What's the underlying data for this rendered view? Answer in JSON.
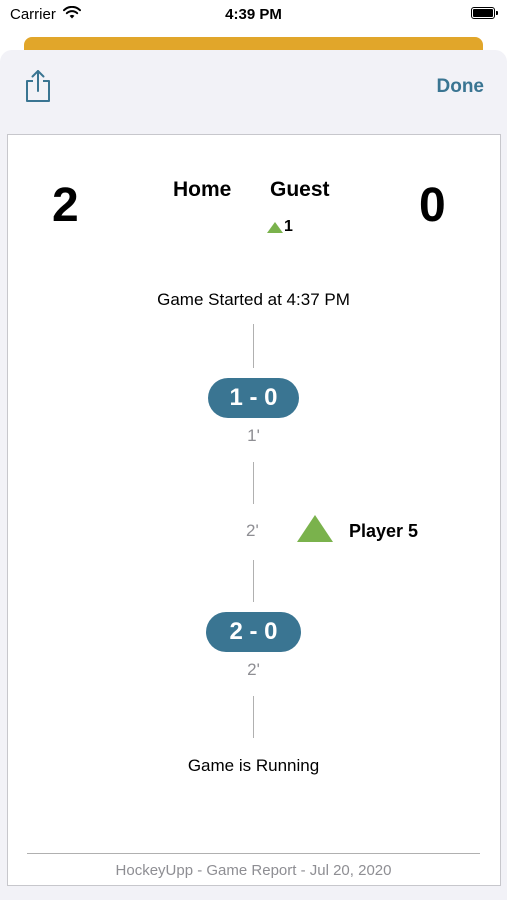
{
  "status_bar": {
    "carrier": "Carrier",
    "time": "4:39 PM"
  },
  "toolbar": {
    "done_label": "Done",
    "share_icon": "share-icon"
  },
  "scoreboard": {
    "home_name": "Home",
    "guest_name": "Guest",
    "home_score": "2",
    "guest_score": "0",
    "guest_penalty_count": "1"
  },
  "timeline": {
    "start_text": "Game Started at 4:37 PM",
    "goal1": {
      "score": "1 - 0",
      "minute": "1'"
    },
    "penalty": {
      "minute": "2'",
      "player": "Player 5"
    },
    "goal2": {
      "score": "2 - 0",
      "minute": "2'"
    },
    "status_text": "Game is Running"
  },
  "footer": {
    "text": "HockeyUpp - Game Report - Jul 20, 2020"
  },
  "colors": {
    "accent": "#3a7592",
    "penalty": "#7ab24c",
    "behind_sheet": "#e1a62a"
  }
}
